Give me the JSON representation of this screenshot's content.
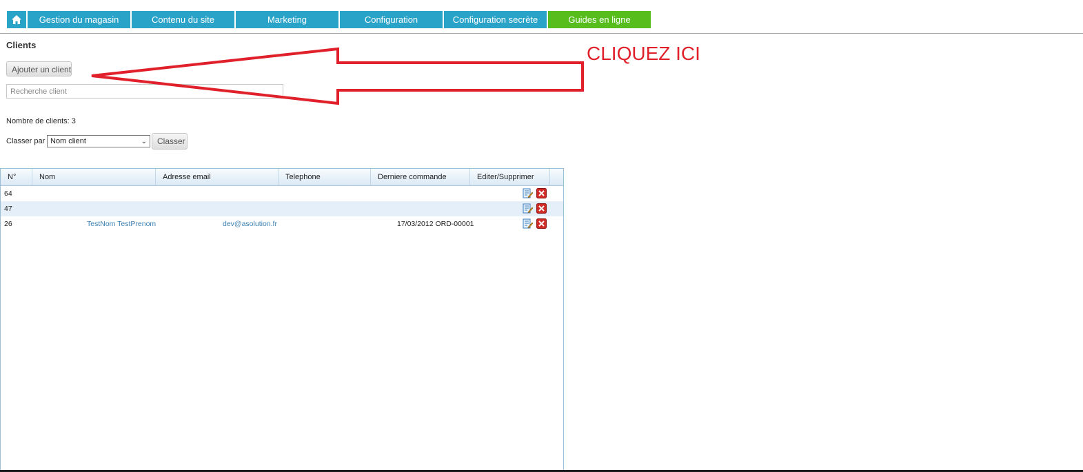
{
  "nav": {
    "home_icon": "home-icon",
    "tabs": [
      {
        "label": "Gestion du magasin",
        "color": "#2aa3c9"
      },
      {
        "label": "Contenu du site",
        "color": "#2aa3c9"
      },
      {
        "label": "Marketing",
        "color": "#2aa3c9"
      },
      {
        "label": "Configuration",
        "color": "#2aa3c9"
      },
      {
        "label": "Configuration secrète",
        "color": "#2aa3c9"
      },
      {
        "label": "Guides en ligne",
        "color": "#56bd1d"
      }
    ]
  },
  "page": {
    "title": "Clients",
    "add_button": "Ajouter un client",
    "search_placeholder": "Recherche client",
    "count_text": "Nombre de clients: 3",
    "sort_label": "Classer par",
    "sort_selected": "Nom client",
    "sort_button": "Classer"
  },
  "table": {
    "headers": [
      "N°",
      "Nom",
      "Adresse email",
      "Telephone",
      "Derniere commande",
      "Editer/Supprimer"
    ],
    "rows": [
      {
        "id": "64",
        "name": "",
        "email": "",
        "phone": "",
        "last_order": ""
      },
      {
        "id": "47",
        "name": "",
        "email": "",
        "phone": "",
        "last_order": ""
      },
      {
        "id": "26",
        "name": "TestNom TestPrenom",
        "email": "dev@asolution.fr",
        "phone": "",
        "last_order": "17/03/2012 ORD-00001"
      }
    ],
    "edit_icon": "edit-icon",
    "delete_icon": "delete-icon"
  },
  "annotation": {
    "text": "CLIQUEZ ICI",
    "color": "#e0202a"
  }
}
